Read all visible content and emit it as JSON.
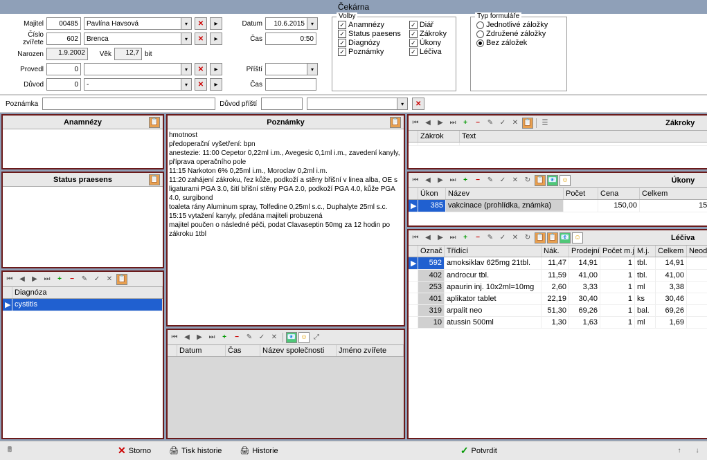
{
  "title": "Čekárna",
  "form": {
    "owner_label": "Majitel",
    "owner_id": "00485",
    "owner_name": "Pavlína Havsová",
    "animal_label": "Číslo zvířete",
    "animal_id": "602",
    "animal_name": "Brenca",
    "born_label": "Narozen",
    "born": "1.9.2002",
    "age_label": "Věk",
    "age": "12,7",
    "age_unit": "bit",
    "provedl_label": "Provedl",
    "provedl": "0",
    "duvod_label": "Důvod",
    "duvod_id": "0",
    "duvod_text": "-",
    "datum_label": "Datum",
    "datum": "10.6.2015",
    "cas_label": "Čas",
    "cas": "0:50",
    "pristi_label": "Příští",
    "pristi": "",
    "cas2": ""
  },
  "volby": {
    "title": "Volby",
    "anamnezy": "Anamnézy",
    "status": "Status paesens",
    "diagnozy": "Diagnózy",
    "poznamky": "Poznámky",
    "diar": "Diář",
    "zakroky": "Zákroky",
    "ukony": "Úkony",
    "leciva": "Léčiva"
  },
  "typf": {
    "title": "Typ formuláře",
    "r1": "Jednotlivé záložky",
    "r2": "Združené záložky",
    "r3": "Bez záložek"
  },
  "noterow": {
    "poznamka_label": "Poznámka",
    "duvod_pristi_label": "Důvod příští"
  },
  "panels": {
    "anamnezy": "Anamnézy",
    "status": "Status praesens",
    "diagnozy_col": "Diagnóza",
    "diagnozy_val": "cystitis",
    "poznamky": "Poznámky",
    "poznamky_text": "hmotnost\npředoperační vyšetření: bpn\nanestezie: 11:00 Cepetor 0,22ml i.m., Avegesic 0,1ml i.m., zavedení kanyly, příprava operačního pole\n11:15 Narkoton 6% 0,25ml i.m., Moroclav 0,2ml i.m.\n11:20 zahájení zákroku, řez kůže, podkoží a stěny břišní v linea alba, OE s ligaturami PGA 3.0, šití břišní stěny PGA 2.0, podkoží PGA 4.0, kůže PGA 4.0, surgibond\ntoaleta rány Aluminum spray, Tolfedine 0,25ml s.c., Duphalyte 25ml s.c.\n15:15 vytažení kanyly, předána majiteli probuzená\nmajitel poučen o následné péči, podat Clavaseptin 50mg za 12 hodin po zákroku 1tbl",
    "zakroky": "Zákroky",
    "zakrok_col1": "Zákrok",
    "zakrok_col2": "Text",
    "ukony": "Úkony",
    "ukony_cols": [
      "Úkon",
      "Název",
      "Počet",
      "Cena",
      "Celkem"
    ],
    "ukony_row": [
      "385",
      "vakcinace (prohlídka, známka)",
      "",
      "150,00",
      "15"
    ],
    "leciva": "Léčiva",
    "leciva_cols": [
      "Označ",
      "Třídící",
      "Nák.",
      "Prodejní",
      "Počet m.j.",
      "M.j.",
      "Celkem",
      "Neod"
    ],
    "leciva_rows": [
      [
        "592",
        "amoksiklav 625mg 21tbl.",
        "11,47",
        "14,91",
        "1",
        "tbl.",
        "14,91",
        ""
      ],
      [
        "402",
        "androcur tbl.",
        "11,59",
        "41,00",
        "1",
        "tbl.",
        "41,00",
        ""
      ],
      [
        "253",
        "apaurin inj. 10x2ml=10mg",
        "2,60",
        "3,33",
        "1",
        "ml",
        "3,38",
        ""
      ],
      [
        "401",
        "aplikator tablet",
        "22,19",
        "30,40",
        "1",
        "ks",
        "30,46",
        ""
      ],
      [
        "319",
        "arpalit neo",
        "51,30",
        "69,26",
        "1",
        "bal.",
        "69,26",
        ""
      ],
      [
        "10",
        "atussin 500ml",
        "1,30",
        "1,63",
        "1",
        "ml",
        "1,69",
        ""
      ]
    ],
    "hist_cols": [
      "Datum",
      "Čas",
      "Název společnosti",
      "Jméno zvířete"
    ]
  },
  "footer": {
    "storno": "Storno",
    "tisk": "Tisk historie",
    "historie": "Historie",
    "potvrdit": "Potvrdit"
  }
}
